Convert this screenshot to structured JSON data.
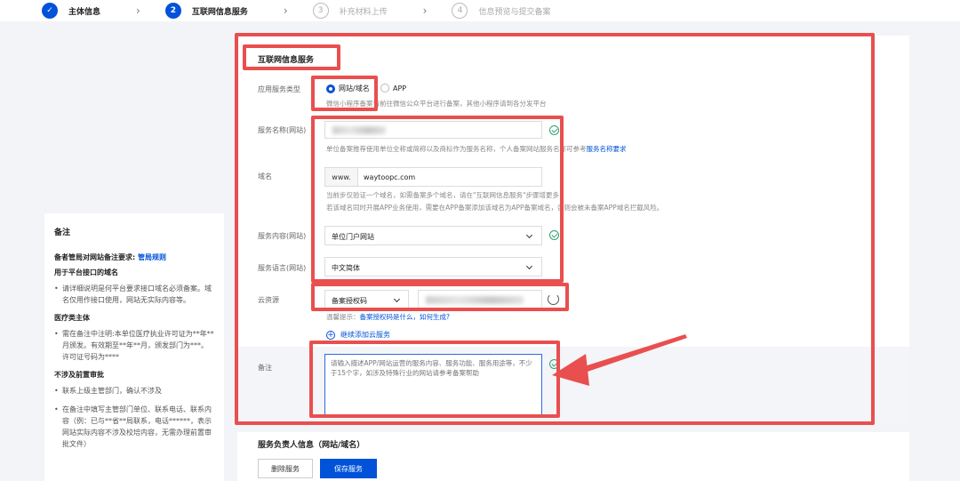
{
  "steps": [
    {
      "num": "1",
      "label": "主体信息"
    },
    {
      "num": "2",
      "label": "互联网信息服务"
    },
    {
      "num": "3",
      "label": "补充材料上传"
    },
    {
      "num": "4",
      "label": "信息预览与提交备案"
    }
  ],
  "notes": {
    "title": "备注",
    "req_text": "备者管局对网站备注要求:",
    "req_link": "管局规则",
    "sections": [
      {
        "heading": "用于平台接口的域名",
        "items": [
          "请详细说明是何平台要求接口域名必须备案。域名仅用作接口使用，网站无实际内容等。"
        ]
      },
      {
        "heading": "医疗类主体",
        "items": [
          "需在备注中注明:本单位医疗执业许可证为**年**月颁发。有效期至**年**月，颁发部门为***。许可证号码为****"
        ]
      },
      {
        "heading": "不涉及前置审批",
        "items": [
          "联系上级主管部门，确认不涉及",
          "在备注中填写主管部门单位、联系电话、联系内容（例：已与**省**局联系，电话******，表示网站实际内容不涉及校培内容，无需办理前置审批文件）"
        ]
      }
    ]
  },
  "form": {
    "section_title": "互联网信息服务",
    "app_type_label": "应用服务类型",
    "app_type_options": [
      "网站/域名",
      "APP"
    ],
    "app_type_hint": "微信小程序备案请前往微信公众平台进行备案，其他小程序请到各分发平台",
    "service_name_label": "服务名称(网站)",
    "service_name_hint": "单位备案推荐使用单位全称或简称以及商标作为服务名称，个人备案网站服务名称可参考",
    "service_name_link": "服务名称要求",
    "domain_label": "域名",
    "domain_prefix": "www.",
    "domain_value": "waytoopc.com",
    "domain_hint1": "当前步仅验证一个域名，如需备案多个域名，请在\"互联网信息服务\"步骤增更多",
    "domain_hint2": "若该域名同时开展APP业务使用，需要在APP备案添加该域名为APP备案域名，否则会被未备案APP域名拦截风险。",
    "content_label": "服务内容(网站)",
    "content_value": "单位门户网站",
    "language_label": "服务语言(网站)",
    "language_value": "中文简体",
    "cloud_label": "云资源",
    "cloud_select": "备案授权码",
    "cloud_tip_prefix": "温馨提示：",
    "cloud_tip_link": "备案授权码是什么，如何生成?",
    "add_cloud": "继续添加云服务",
    "remark_label": "备注",
    "remark_placeholder": "请输入描述APP/网站运营的服务内容、服务功能、服务用途等，不少于15个字，如涉及特殊行业的网站请参考备案帮助"
  },
  "section2": {
    "title": "服务负责人信息（网站/域名）",
    "delete_btn": "删除服务",
    "save_btn": "保存服务"
  },
  "colors": {
    "brand": "#0052d9",
    "annotation": "#e94f4f",
    "ok": "#2ba471"
  }
}
